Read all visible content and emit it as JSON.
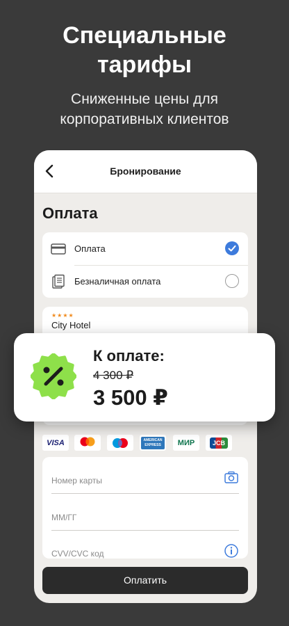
{
  "headline": {
    "line1": "Специальные",
    "line2": "тарифы"
  },
  "subline": {
    "line1": "Сниженные цены для",
    "line2": "корпоративных клиентов"
  },
  "nav": {
    "title": "Бронирование"
  },
  "payment": {
    "title": "Оплата",
    "options": [
      {
        "label": "Оплата",
        "selected": true,
        "icon": "credit-card-icon"
      },
      {
        "label": "Безналичная оплата",
        "selected": false,
        "icon": "documents-icon"
      }
    ]
  },
  "hotel": {
    "stars": "★★★★",
    "name": "City Hotel"
  },
  "card_logos": [
    "VISA",
    "mastercard",
    "Maestro",
    "AMERICAN EXPRESS",
    "МИР",
    "JCB"
  ],
  "card_form": {
    "number_placeholder": "Номер карты",
    "expiry_placeholder": "ММ/ГГ",
    "cvv_placeholder": "CVV/CVC код"
  },
  "pay_button": {
    "label": "Оплатить"
  },
  "promo": {
    "label": "К оплате:",
    "old_price": "4 300 ₽",
    "new_price": "3 500 ₽",
    "badge_color": "#8ee04a"
  },
  "colors": {
    "background": "#3a3a3a",
    "accent": "#3d7bdc",
    "button": "#2b2b2b"
  }
}
